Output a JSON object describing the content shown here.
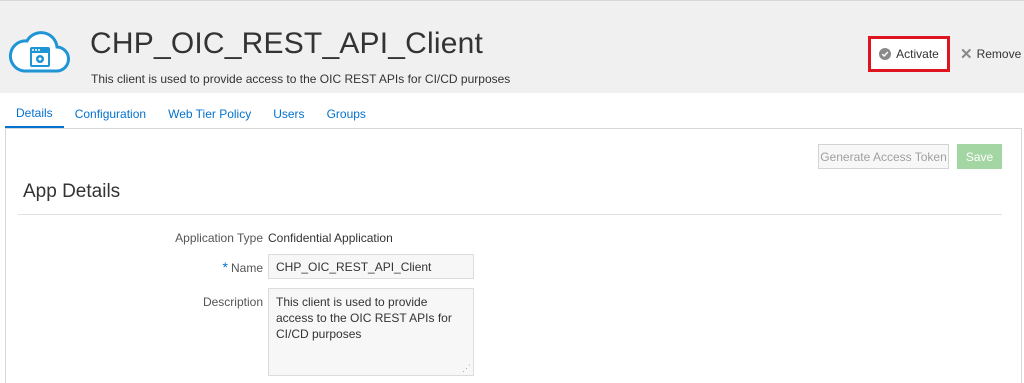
{
  "header": {
    "title": "CHP_OIC_REST_API_Client",
    "subtitle": "This client is used to provide access to the OIC REST APIs for CI/CD purposes",
    "icon": "cloud-app-icon",
    "actions": {
      "activate_label": "Activate",
      "remove_label": "Remove",
      "highlight_color": "#e0141e"
    }
  },
  "tabs": [
    {
      "label": "Details",
      "active": true
    },
    {
      "label": "Configuration",
      "active": false
    },
    {
      "label": "Web Tier Policy",
      "active": false
    },
    {
      "label": "Users",
      "active": false
    },
    {
      "label": "Groups",
      "active": false
    }
  ],
  "toolbar": {
    "generate_label": "Generate Access Token",
    "save_label": "Save"
  },
  "section": {
    "title": "App Details"
  },
  "form": {
    "app_type_label": "Application Type",
    "app_type_value": "Confidential Application",
    "name_required_mark": "*",
    "name_label": "Name",
    "name_value": "CHP_OIC_REST_API_Client",
    "description_label": "Description",
    "description_value": "This client is used to provide access to the OIC REST APIs for CI/CD purposes"
  },
  "colors": {
    "accent": "#0572ce",
    "save_disabled": "#a4d6a4",
    "header_bg": "#f0f0f0"
  }
}
